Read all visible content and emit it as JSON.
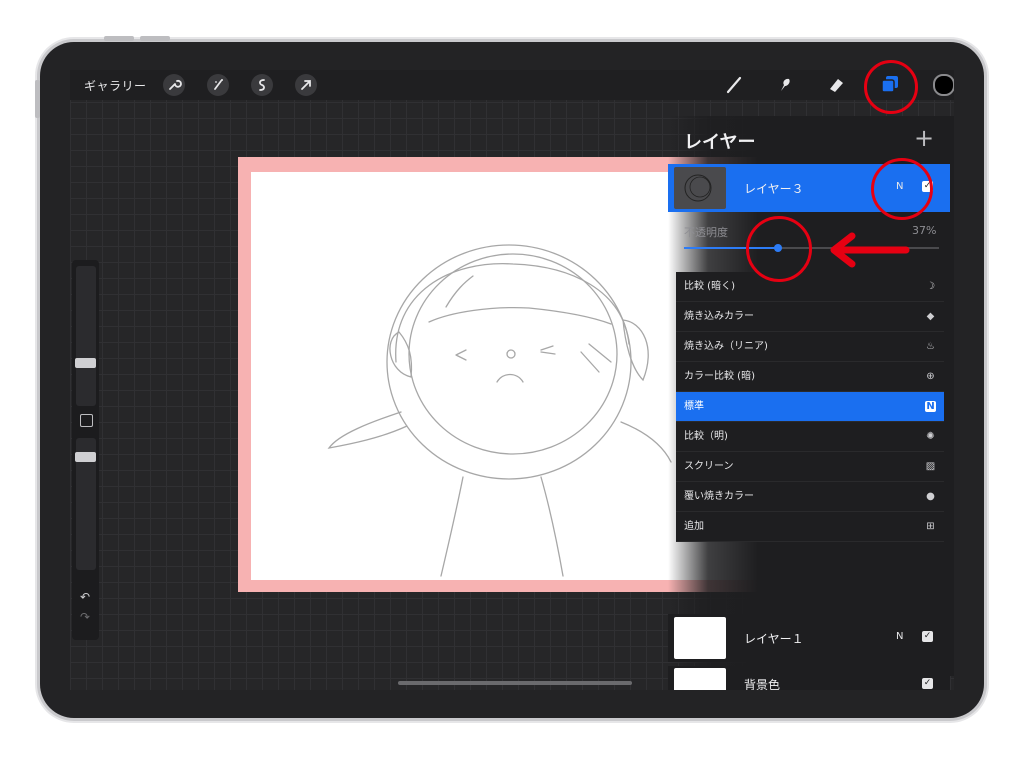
{
  "toolbar": {
    "gallery_label": "ギャラリー",
    "left_icons": [
      "wrench-icon",
      "magic-wand-icon",
      "selection-icon",
      "transform-arrow-icon"
    ],
    "right_icons": [
      "brush-icon",
      "smudge-icon",
      "eraser-icon",
      "layers-icon",
      "color-swatch"
    ],
    "current_color": "#000000"
  },
  "layers_panel": {
    "title": "レイヤー",
    "add_symbol": "+",
    "active_layer": {
      "name": "レイヤー３",
      "blend_mode_letter": "N",
      "visible": true
    },
    "opacity": {
      "label": "不透明度",
      "value_text": "37%",
      "value": 0.37
    },
    "blend_modes": [
      {
        "label": "比較 (暗く)",
        "icon": "moon-icon"
      },
      {
        "label": "焼き込みカラー",
        "icon": "burn-icon"
      },
      {
        "label": "焼き込み（リニア)",
        "icon": "flame-icon"
      },
      {
        "label": "カラー比較 (暗)",
        "icon": "plus-circle-icon"
      },
      {
        "label": "標準",
        "icon": "n-badge-icon",
        "selected": true
      },
      {
        "label": "比較（明)",
        "icon": "sun-icon"
      },
      {
        "label": "スクリーン",
        "icon": "hatch-icon"
      },
      {
        "label": "覆い焼きカラー",
        "icon": "dodge-icon"
      },
      {
        "label": "追加",
        "icon": "plus-square-icon"
      }
    ],
    "other_layers": [
      {
        "name": "レイヤー１",
        "blend_mode_letter": "N",
        "visible": true
      },
      {
        "name": "背景色",
        "blend_mode_letter": "",
        "visible": true
      }
    ]
  },
  "colors": {
    "accent": "#1a6ff0",
    "annotation": "#e60012",
    "canvas_border": "#f7b2b2"
  }
}
